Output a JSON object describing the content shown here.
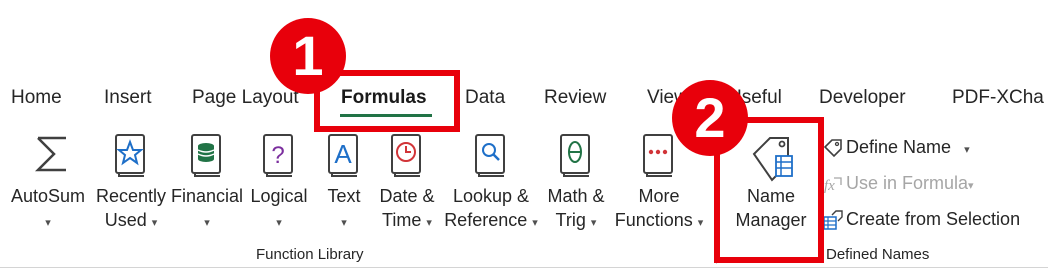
{
  "tabs": [
    {
      "label": "Home",
      "active": false
    },
    {
      "label": "Insert",
      "active": false
    },
    {
      "label": "Page Layout",
      "active": false
    },
    {
      "label": "Formulas",
      "active": true
    },
    {
      "label": "Data",
      "active": false
    },
    {
      "label": "Review",
      "active": false
    },
    {
      "label": "View",
      "active": false
    },
    {
      "label": "Useful",
      "active": false
    },
    {
      "label": "Developer",
      "active": false
    },
    {
      "label": "PDF-XCha",
      "active": false
    }
  ],
  "function_library": {
    "group_label": "Function Library",
    "buttons": [
      {
        "line1": "AutoSum",
        "line2": "",
        "icon": "sigma-icon"
      },
      {
        "line1": "Recently",
        "line2": "Used",
        "icon": "star-book-icon"
      },
      {
        "line1": "Financial",
        "line2": "",
        "icon": "coins-book-icon"
      },
      {
        "line1": "Logical",
        "line2": "",
        "icon": "question-book-icon"
      },
      {
        "line1": "Text",
        "line2": "",
        "icon": "letter-a-book-icon"
      },
      {
        "line1": "Date &",
        "line2": "Time",
        "icon": "clock-book-icon"
      },
      {
        "line1": "Lookup &",
        "line2": "Reference",
        "icon": "magnifier-book-icon"
      },
      {
        "line1": "Math &",
        "line2": "Trig",
        "icon": "theta-book-icon"
      },
      {
        "line1": "More",
        "line2": "Functions",
        "icon": "dots-book-icon"
      }
    ]
  },
  "defined_names": {
    "group_label": "Defined Names",
    "name_manager": {
      "line1": "Name",
      "line2": "Manager",
      "icon": "name-tag-icon"
    },
    "define_name": {
      "label": "Define Name",
      "icon": "tag-icon"
    },
    "use_in_formula": {
      "label": "Use in Formula",
      "icon": "fx-icon",
      "disabled": true
    },
    "create_from_selection": {
      "label": "Create from Selection",
      "icon": "grid-tag-icon"
    }
  },
  "annotations": [
    {
      "number": "1",
      "target": "Formulas"
    },
    {
      "number": "2",
      "target": "Name Manager"
    }
  ],
  "colors": {
    "accent": "#217346",
    "highlight": "#e8000b",
    "icon_blue": "#1e6fc8",
    "icon_green": "#217346",
    "icon_purple": "#7b2e9e",
    "icon_red": "#d13438"
  }
}
